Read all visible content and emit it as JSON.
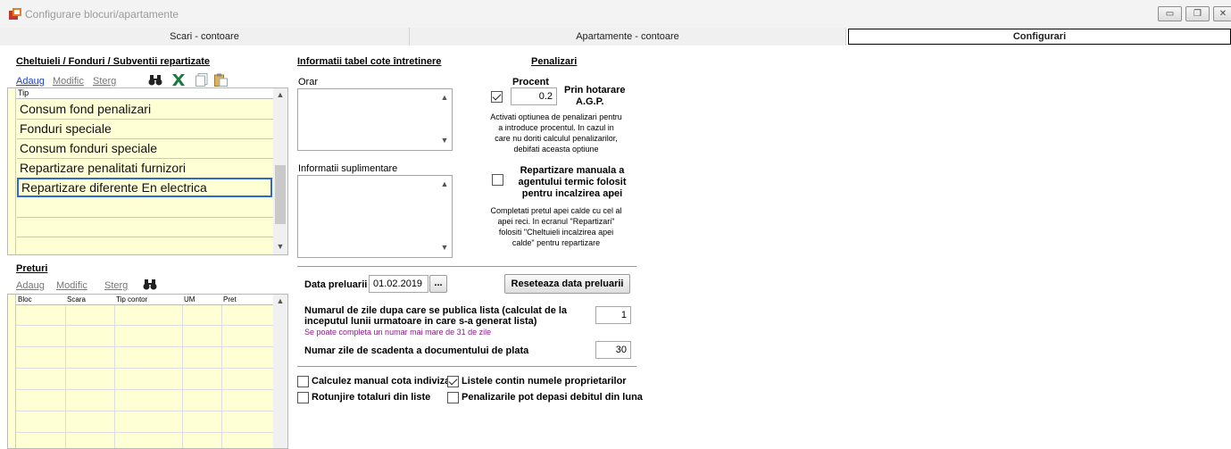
{
  "window": {
    "title": "Configurare blocuri/apartamente",
    "controls": [
      "minimize",
      "restore",
      "close"
    ]
  },
  "tabs": [
    {
      "label": "Scari - contoare",
      "active": false
    },
    {
      "label": "Apartamente - contoare",
      "active": false
    },
    {
      "label": "Configurari",
      "active": true
    }
  ],
  "expenses": {
    "title": "Cheltuieli / Fonduri / Subventii repartizate",
    "toolbar": {
      "add": "Adaug",
      "edit": "Modific",
      "delete": "Sterg"
    },
    "icons": [
      "binoculars-icon",
      "excel-icon",
      "copy-icon",
      "paste-icon"
    ],
    "column": "Tip",
    "rows": [
      "Consum fond penalizari",
      "Fonduri speciale",
      "Consum fonduri speciale",
      "Repartizare penalitati furnizori",
      "Repartizare diferente En electrica"
    ],
    "selected_index": 4
  },
  "prices": {
    "title": "Preturi",
    "toolbar": {
      "add": "Adaug",
      "edit": "Modific",
      "delete": "Sterg"
    },
    "columns": [
      "Bloc",
      "Scara",
      "Tip contor",
      "UM",
      "Pret"
    ]
  },
  "info": {
    "title": "Informatii tabel cote întretinere",
    "schedule_label": "Orar",
    "extra_label": "Informatii suplimentare"
  },
  "penalties": {
    "title": "Penalizari",
    "percent_label": "Procent",
    "percent_value": "0.2",
    "checked": true,
    "agp_label_1": "Prin hotarare",
    "agp_label_2": "A.G.P.",
    "help1_l1": "Activati optiunea de penalizari pentru",
    "help1_l2": "a introduce procentul. In cazul in",
    "help1_l3": "care nu doriti calculul penalizarilor,",
    "help1_l4": "debifati aceasta optiune",
    "manual_l1": "Repartizare manuala a",
    "manual_l2": "agentului termic folosit",
    "manual_l3": "pentru incalzirea apei",
    "manual_checked": false,
    "help2_l1": "Completati pretul  apei calde cu cel al",
    "help2_l2": "apei reci. In ecranul \"Repartizari\"",
    "help2_l3": "folositi \"Cheltuieli  incalzirea apei",
    "help2_l4": "calde\" pentru repartizare"
  },
  "dates": {
    "label": "Data preluarii",
    "value": "01.02.2019",
    "picker": "...",
    "reset": "Reseteaza data preluarii"
  },
  "publish": {
    "label_l1": "Numarul de zile dupa care se publica lista (calculat de la",
    "label_l2": "inceputul lunii urmatoare in care s-a generat lista)",
    "hint": "Se poate completa un numar mai mare de 31 de zile",
    "value": "1",
    "due_label": "Numar zile de scadenta a documentului de plata",
    "due_value": "30"
  },
  "options": {
    "manual_quota": {
      "label": "Calculez manual cota indiviza",
      "checked": false
    },
    "owner_names": {
      "label": "Listele contin numele proprietarilor",
      "checked": true
    },
    "round_totals": {
      "label": "Rotunjire totaluri  din liste",
      "checked": false
    },
    "penalty_exceed": {
      "label": "Penalizarile pot depasi debitul din luna",
      "checked": false
    }
  }
}
